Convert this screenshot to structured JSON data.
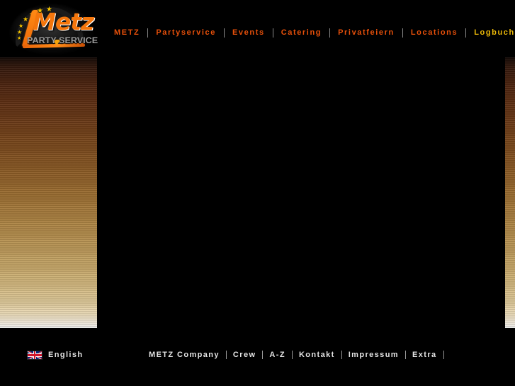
{
  "site": {
    "brand_name": "Metz",
    "brand_tagline": "PARTY SERVICE",
    "accent_orange": "#e8500a",
    "accent_gold": "#eab708",
    "background": "#000000",
    "panel_top_color": "#140a07",
    "panel_bottom_color": "#e9eaea"
  },
  "header": {
    "logo": {
      "wordmark": "Metz",
      "subtitle": "PARTY SERVICE",
      "star_count": 7,
      "star_glyph": "★"
    },
    "nav": {
      "separator": "|",
      "items": [
        {
          "label": "METZ",
          "active": false
        },
        {
          "label": "Partyservice",
          "active": false
        },
        {
          "label": "Events",
          "active": false
        },
        {
          "label": "Catering",
          "active": false
        },
        {
          "label": "Privatfeiern",
          "active": false
        },
        {
          "label": "Locations",
          "active": false
        },
        {
          "label": "Logbuch",
          "active": true
        }
      ]
    }
  },
  "main": {
    "content_text": ""
  },
  "footer": {
    "language": {
      "flag": "uk-flag-icon",
      "label": "English"
    },
    "nav": {
      "separator": "|",
      "items": [
        {
          "label": "METZ  Company"
        },
        {
          "label": "Crew"
        },
        {
          "label": "A-Z"
        },
        {
          "label": "Kontakt"
        },
        {
          "label": "Impressum"
        },
        {
          "label": "Extra"
        }
      ]
    }
  }
}
